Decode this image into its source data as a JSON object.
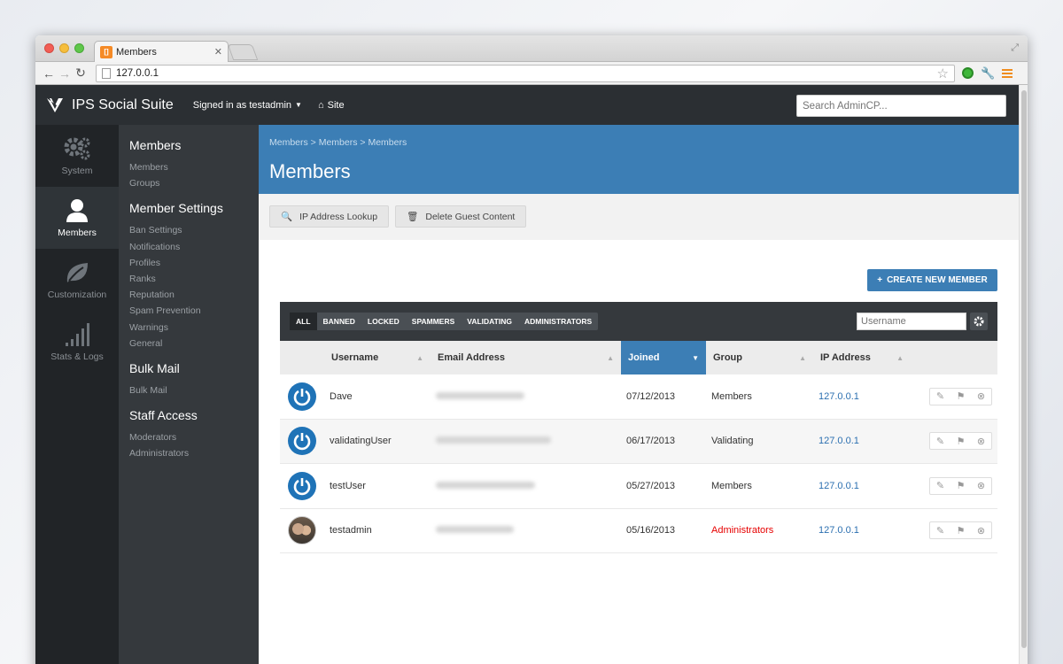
{
  "browser": {
    "tab_title": "Members",
    "favicon_text": "[]",
    "url": "127.0.0.1"
  },
  "app": {
    "logo_text": "IPS Social Suite",
    "signed_in": "Signed in as testadmin",
    "site_link": "Site",
    "search_placeholder": "Search AdminCP..."
  },
  "iconnav": [
    {
      "label": "System",
      "icon": "gears-icon",
      "active": false
    },
    {
      "label": "Members",
      "icon": "user-icon",
      "active": true
    },
    {
      "label": "Customization",
      "icon": "leaf-icon",
      "active": false
    },
    {
      "label": "Stats & Logs",
      "icon": "bar-chart-icon",
      "active": false
    }
  ],
  "subnav": {
    "groups": [
      {
        "heading": "Members",
        "links": [
          "Members",
          "Groups"
        ]
      },
      {
        "heading": "Member Settings",
        "links": [
          "Ban Settings",
          "Notifications",
          "Profiles",
          "Ranks",
          "Reputation",
          "Spam Prevention",
          "Warnings",
          "General"
        ]
      },
      {
        "heading": "Bulk Mail",
        "links": [
          "Bulk Mail"
        ]
      },
      {
        "heading": "Staff Access",
        "links": [
          "Moderators",
          "Administrators"
        ]
      }
    ]
  },
  "main": {
    "breadcrumb": "Members > Members > Members",
    "title": "Members",
    "actions": [
      {
        "label": "IP Address Lookup",
        "icon": "search-icon"
      },
      {
        "label": "Delete Guest Content",
        "icon": "trash-icon"
      }
    ],
    "create_label": "CREATE NEW MEMBER"
  },
  "table": {
    "filters": [
      "ALL",
      "BANNED",
      "LOCKED",
      "SPAMMERS",
      "VALIDATING",
      "ADMINISTRATORS"
    ],
    "active_filter": "ALL",
    "username_placeholder": "Username",
    "columns": [
      "Username",
      "Email Address",
      "Joined",
      "Group",
      "IP Address"
    ],
    "active_column": "Joined",
    "rows": [
      {
        "username": "Dave",
        "joined": "07/12/2013",
        "group": "Members",
        "ip": "127.0.0.1",
        "avatar": "power-icon"
      },
      {
        "username": "validatingUser",
        "joined": "06/17/2013",
        "group": "Validating",
        "ip": "127.0.0.1",
        "avatar": "power-icon"
      },
      {
        "username": "testUser",
        "joined": "05/27/2013",
        "group": "Members",
        "ip": "127.0.0.1",
        "avatar": "power-icon"
      },
      {
        "username": "testadmin",
        "joined": "05/16/2013",
        "group": "Administrators",
        "ip": "127.0.0.1",
        "avatar": "photo"
      }
    ]
  },
  "colors": {
    "accent_blue": "#3c7eb5",
    "topbar": "#2b2f33",
    "admin_red": "#e60000"
  }
}
